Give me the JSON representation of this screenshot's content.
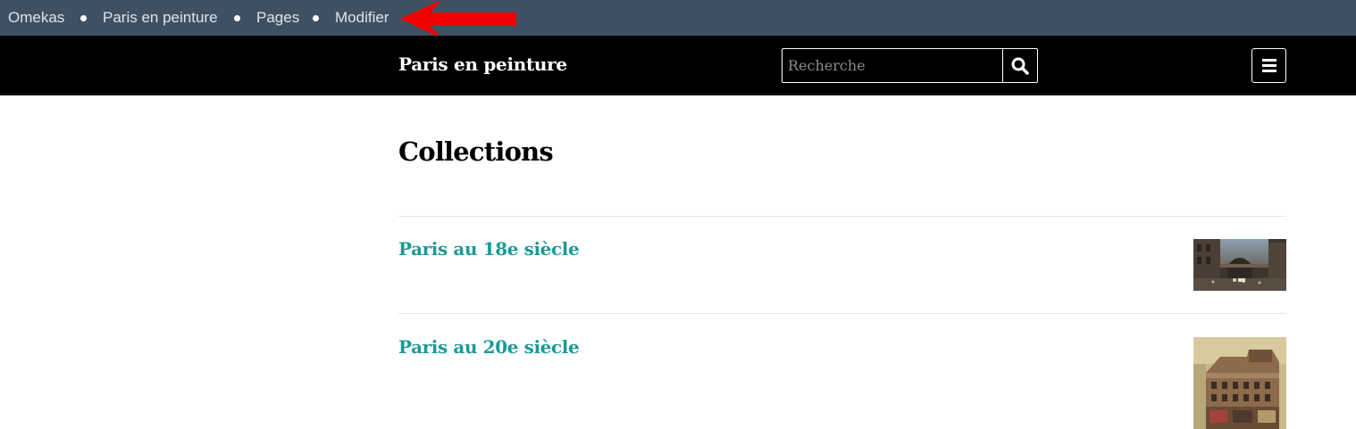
{
  "admin_bar": {
    "breadcrumbs": [
      {
        "label": "Omekas"
      },
      {
        "label": "Paris en peinture"
      },
      {
        "label": "Pages"
      },
      {
        "label": "Modifier"
      }
    ],
    "background": "#3f5062",
    "annotation_arrow_color": "#f20000"
  },
  "header": {
    "site_title": "Paris en peinture",
    "search": {
      "placeholder": "Recherche",
      "value": "",
      "button_icon": "search-icon"
    },
    "menu_icon": "hamburger-icon",
    "background": "#000000"
  },
  "main": {
    "title": "Collections",
    "collections": [
      {
        "title": "Paris au 18e siècle",
        "thumbnail": "painting-thumbnail"
      },
      {
        "title": "Paris au 20e siècle",
        "thumbnail": "painting-thumbnail"
      }
    ],
    "link_color": "#1c9a97"
  }
}
